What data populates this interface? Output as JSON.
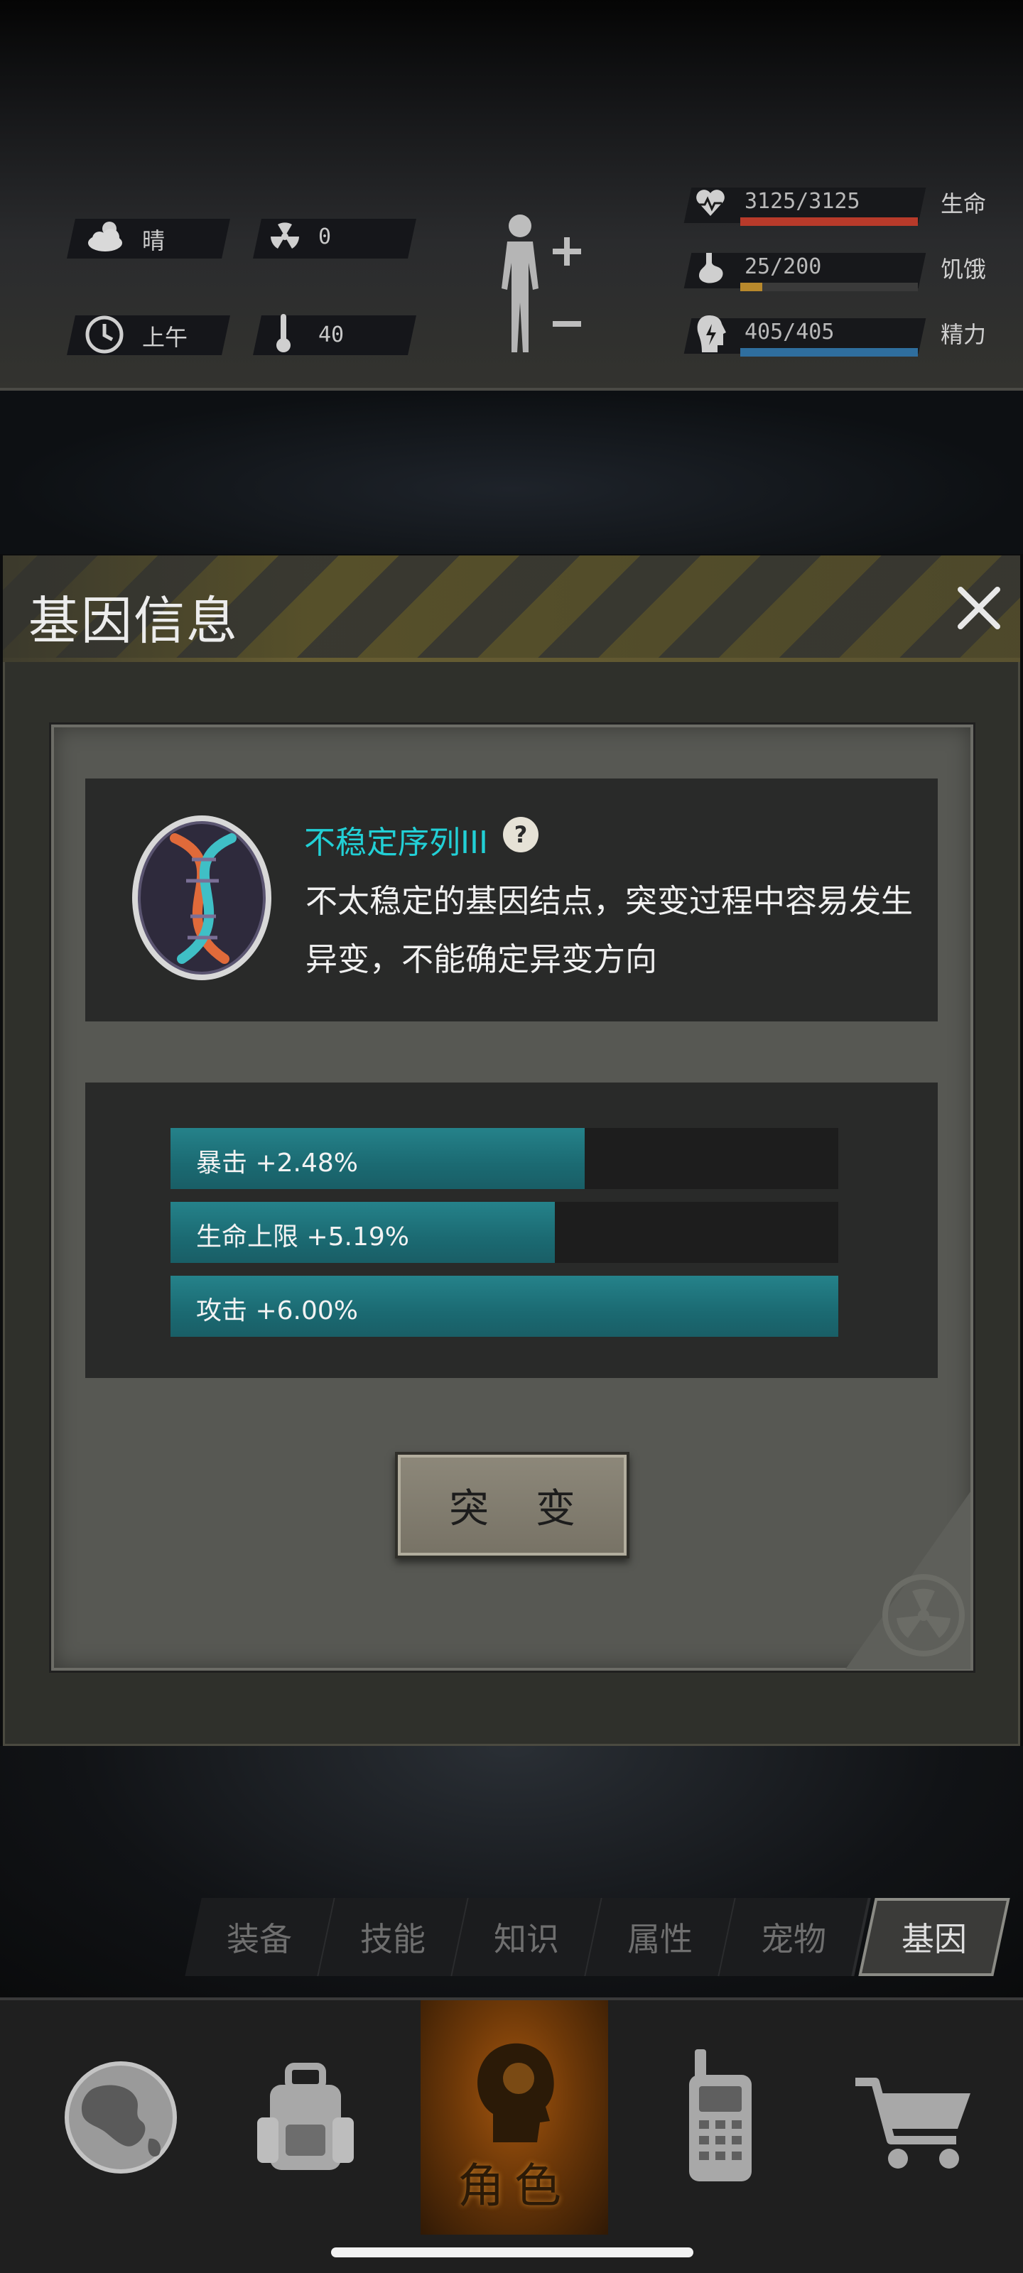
{
  "status": {
    "weather": "晴",
    "radiation": "0",
    "time_of_day": "上午",
    "temperature": "40",
    "stats": [
      {
        "value": "3125/3125",
        "label": "生命",
        "fill_fraction": 1.0,
        "color": "#b83a2a",
        "icon": "heart-icon"
      },
      {
        "value": "25/200",
        "label": "饥饿",
        "fill_fraction": 0.125,
        "color": "#b8892c",
        "icon": "stomach-icon"
      },
      {
        "value": "405/405",
        "label": "精力",
        "fill_fraction": 1.0,
        "color": "#2f6e9e",
        "icon": "energy-icon"
      }
    ]
  },
  "dialog": {
    "title": "基因信息",
    "gene_name": "不稳定序列III",
    "gene_description": "不太稳定的基因结点，突变过程中容易发生异变，不能确定异变方向",
    "attributes": [
      {
        "label": "暴击 +2.48%",
        "fill_fraction": 0.62
      },
      {
        "label": "生命上限 +5.19%",
        "fill_fraction": 0.575
      },
      {
        "label": "攻击 +6.00%",
        "fill_fraction": 1.0
      }
    ],
    "mutate_button": "突 变"
  },
  "tabs": [
    {
      "label": "装备",
      "active": false
    },
    {
      "label": "技能",
      "active": false
    },
    {
      "label": "知识",
      "active": false
    },
    {
      "label": "属性",
      "active": false
    },
    {
      "label": "宠物",
      "active": false
    },
    {
      "label": "基因",
      "active": true
    }
  ],
  "nav": {
    "items": [
      "globe-icon",
      "backpack-icon",
      "character-icon",
      "radio-icon",
      "cart-icon"
    ],
    "active_label": "角色"
  },
  "colors": {
    "accent_cyan": "#22d0d6",
    "bar_teal": "#1f7880",
    "hazard_yellow": "#6f6428",
    "nav_active_orange": "#a4560f"
  }
}
